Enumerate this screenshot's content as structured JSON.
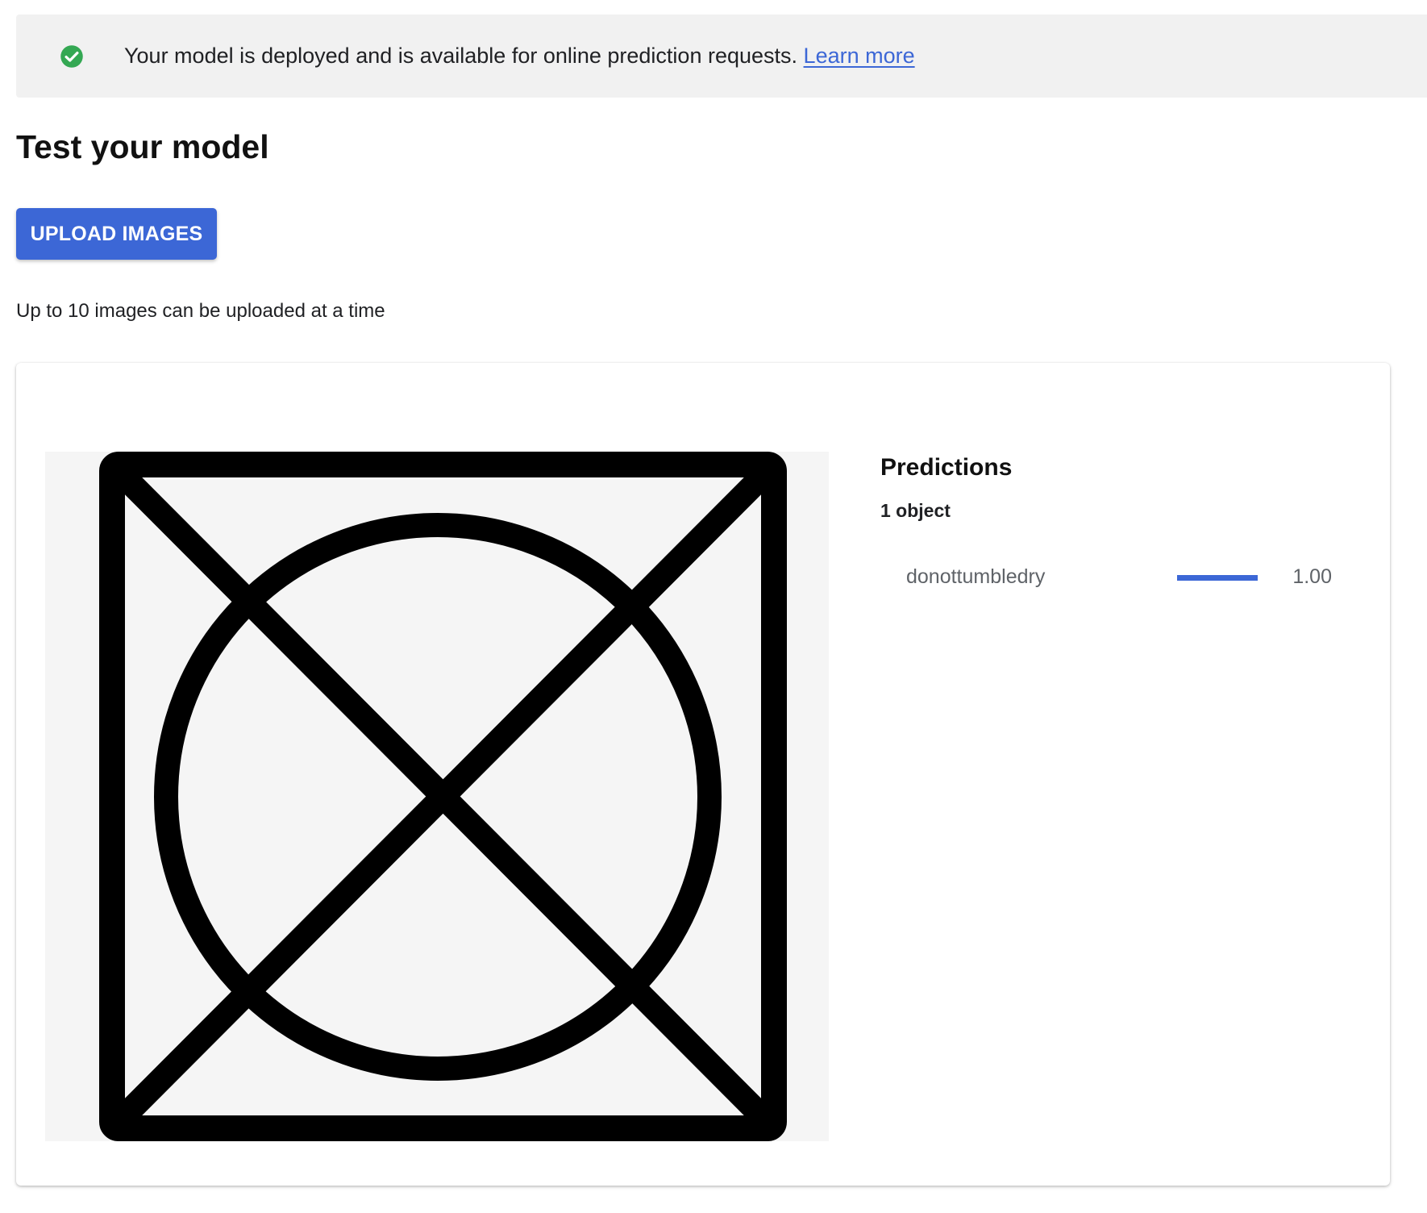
{
  "banner": {
    "status_icon": "check-circle-icon",
    "status_color": "#34a853",
    "message": "Your model is deployed and is available for online prediction requests.",
    "link_label": "Learn more"
  },
  "page_title": "Test your model",
  "upload": {
    "button_label": "UPLOAD IMAGES",
    "hint": "Up to 10 images can be uploaded at a time",
    "accent_color": "#3c67d6"
  },
  "result": {
    "image_subject": "do-not-tumble-dry-symbol",
    "predictions": {
      "title": "Predictions",
      "object_count": "1 object",
      "items": [
        {
          "label": "donottumbledry",
          "score": 1.0,
          "score_text": "1.00"
        }
      ]
    }
  }
}
